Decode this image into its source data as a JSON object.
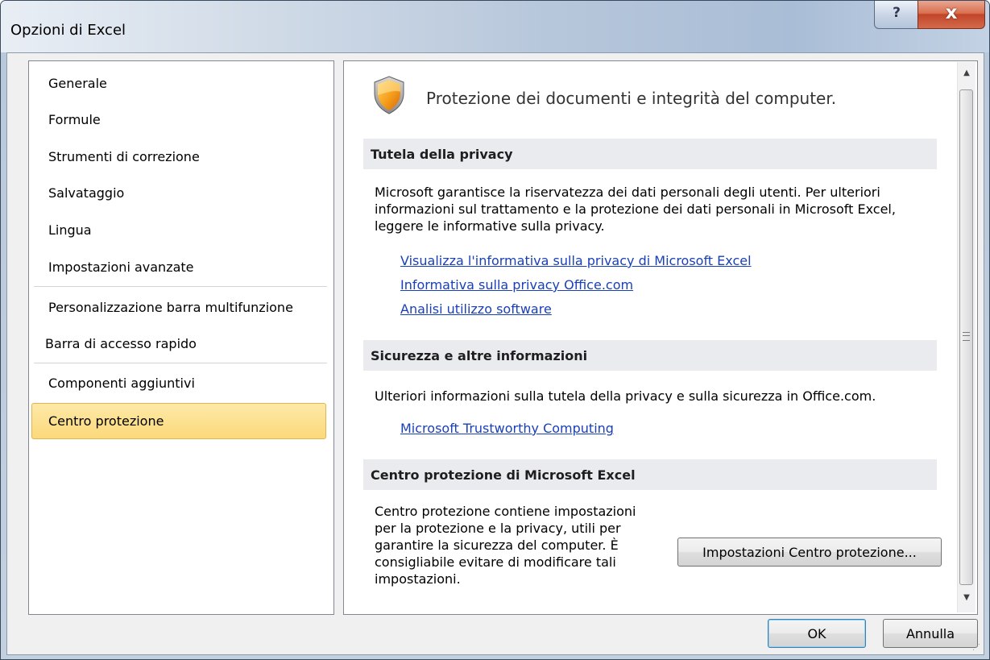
{
  "window": {
    "title": "Opzioni di Excel",
    "help_glyph": "?",
    "close_glyph": "x"
  },
  "nav": {
    "items": [
      {
        "label": "Generale"
      },
      {
        "label": "Formule"
      },
      {
        "label": "Strumenti di correzione"
      },
      {
        "label": "Salvataggio"
      },
      {
        "label": "Lingua"
      },
      {
        "label": "Impostazioni avanzate"
      },
      {
        "label": "Personalizzazione barra multifunzione"
      },
      {
        "label": "Barra di accesso rapido"
      },
      {
        "label": "Componenti aggiuntivi"
      },
      {
        "label": "Centro protezione",
        "selected": true
      }
    ]
  },
  "panel": {
    "heading": "Protezione dei documenti e integrità del computer.",
    "icon": "shield-icon",
    "sections": {
      "privacy": {
        "title": "Tutela della privacy",
        "text": "Microsoft garantisce la riservatezza dei dati personali degli utenti. Per ulteriori informazioni sul trattamento e la protezione dei dati personali in Microsoft Excel, leggere le informative sulla privacy.",
        "links": [
          "Visualizza l'informativa sulla privacy di Microsoft Excel",
          "Informativa sulla privacy Office.com",
          "Analisi utilizzo software"
        ]
      },
      "security": {
        "title": "Sicurezza e altre informazioni",
        "text": "Ulteriori informazioni sulla tutela della privacy e sulla sicurezza in Office.com.",
        "link": "Microsoft Trustworthy Computing"
      },
      "trust_center": {
        "title": "Centro protezione di Microsoft Excel",
        "text": "Centro protezione contiene impostazioni per la protezione e la privacy, utili per garantire la sicurezza del computer. È consigliabile evitare di modificare tali impostazioni.",
        "button": "Impostazioni Centro protezione..."
      }
    }
  },
  "footer": {
    "ok_label": "OK",
    "cancel_label": "Annulla"
  },
  "colors": {
    "link": "#1a40b8",
    "selected_bg": "#fcd97a",
    "section_bg": "#e9ebee"
  }
}
